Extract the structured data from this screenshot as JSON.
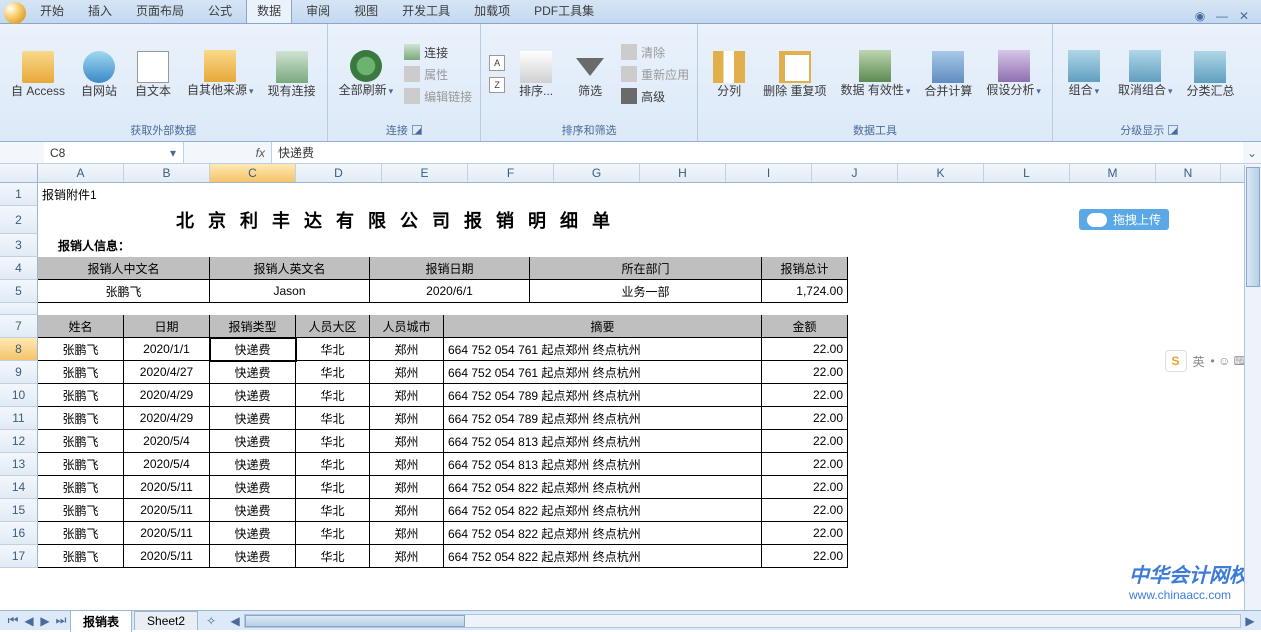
{
  "tabs": {
    "t0": "开始",
    "t1": "插入",
    "t2": "页面布局",
    "t3": "公式",
    "t4": "数据",
    "t5": "审阅",
    "t6": "视图",
    "t7": "开发工具",
    "t8": "加载项",
    "t9": "PDF工具集",
    "active": 4
  },
  "ribbon": {
    "ext": {
      "access": "自 Access",
      "web": "自网站",
      "text": "自文本",
      "other": "自其他来源",
      "exist": "现有连接",
      "group": "获取外部数据"
    },
    "conn": {
      "refresh": "全部刷新",
      "c1": "连接",
      "c2": "属性",
      "c3": "编辑链接",
      "group": "连接"
    },
    "sort": {
      "az": "A→Z",
      "za": "Z→A",
      "sort": "排序...",
      "filter": "筛选",
      "clear": "清除",
      "reapply": "重新应用",
      "adv": "高级",
      "group": "排序和筛选"
    },
    "tools": {
      "split": "分列",
      "dup": "删除\n重复项",
      "valid": "数据\n有效性",
      "consol": "合并计算",
      "whatif": "假设分析",
      "group": "数据工具"
    },
    "outline": {
      "grp": "组合",
      "ungrp": "取消组合",
      "subtotal": "分类汇总",
      "group": "分级显示"
    }
  },
  "fx": {
    "name": "C8",
    "fxlabel": "fx",
    "value": "快递费"
  },
  "cols": [
    "A",
    "B",
    "C",
    "D",
    "E",
    "F",
    "G",
    "H",
    "I",
    "J",
    "K",
    "L",
    "M",
    "N"
  ],
  "row1_label": "报销附件1",
  "title": "北京利丰达有限公司报销明细单",
  "info_label": "报销人信息：",
  "info_hdr": {
    "a": "报销人中文名",
    "b": "报销人英文名",
    "c": "报销日期",
    "d": "所在部门",
    "e": "报销总计"
  },
  "info_val": {
    "a": "张鹏飞",
    "b": "Jason",
    "c": "2020/6/1",
    "d": "业务一部",
    "e": "1,724.00"
  },
  "tbl_hdr": {
    "name": "姓名",
    "date": "日期",
    "type": "报销类型",
    "region": "人员大区",
    "city": "人员城市",
    "summary": "摘要",
    "amount": "金额"
  },
  "rows": [
    {
      "n": "8",
      "name": "张鹏飞",
      "date": "2020/1/1",
      "type": "快递费",
      "region": "华北",
      "city": "郑州",
      "summary": "664 752 054 761 起点郑州 终点杭州",
      "amount": "22.00"
    },
    {
      "n": "9",
      "name": "张鹏飞",
      "date": "2020/4/27",
      "type": "快递费",
      "region": "华北",
      "city": "郑州",
      "summary": "664 752 054 761 起点郑州 终点杭州",
      "amount": "22.00"
    },
    {
      "n": "10",
      "name": "张鹏飞",
      "date": "2020/4/29",
      "type": "快递费",
      "region": "华北",
      "city": "郑州",
      "summary": "664 752 054 789 起点郑州 终点杭州",
      "amount": "22.00"
    },
    {
      "n": "11",
      "name": "张鹏飞",
      "date": "2020/4/29",
      "type": "快递费",
      "region": "华北",
      "city": "郑州",
      "summary": "664 752 054 789 起点郑州 终点杭州",
      "amount": "22.00"
    },
    {
      "n": "12",
      "name": "张鹏飞",
      "date": "2020/5/4",
      "type": "快递费",
      "region": "华北",
      "city": "郑州",
      "summary": "664 752 054 813 起点郑州 终点杭州",
      "amount": "22.00"
    },
    {
      "n": "13",
      "name": "张鹏飞",
      "date": "2020/5/4",
      "type": "快递费",
      "region": "华北",
      "city": "郑州",
      "summary": "664 752 054 813 起点郑州 终点杭州",
      "amount": "22.00"
    },
    {
      "n": "14",
      "name": "张鹏飞",
      "date": "2020/5/11",
      "type": "快递费",
      "region": "华北",
      "city": "郑州",
      "summary": "664 752 054 822 起点郑州 终点杭州",
      "amount": "22.00"
    },
    {
      "n": "15",
      "name": "张鹏飞",
      "date": "2020/5/11",
      "type": "快递费",
      "region": "华北",
      "city": "郑州",
      "summary": "664 752 054 822 起点郑州 终点杭州",
      "amount": "22.00"
    },
    {
      "n": "16",
      "name": "张鹏飞",
      "date": "2020/5/11",
      "type": "快递费",
      "region": "华北",
      "city": "郑州",
      "summary": "664 752 054 822 起点郑州 终点杭州",
      "amount": "22.00"
    },
    {
      "n": "17",
      "name": "张鹏飞",
      "date": "2020/5/11",
      "type": "快递费",
      "region": "华北",
      "city": "郑州",
      "summary": "664 752 054 822 起点郑州 终点杭州",
      "amount": "22.00"
    }
  ],
  "sheets": {
    "s1": "报销表",
    "s2": "Sheet2"
  },
  "upload": "拖拽上传",
  "ime": "英",
  "watermark": {
    "a": "中华会计网校",
    "b": "www.chinaacc.com"
  }
}
